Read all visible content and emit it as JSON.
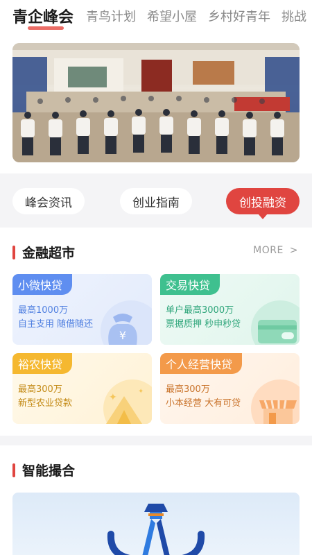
{
  "tabs": [
    {
      "label": "青企峰会",
      "active": true
    },
    {
      "label": "青鸟计划",
      "active": false
    },
    {
      "label": "希望小屋",
      "active": false
    },
    {
      "label": "乡村好青年",
      "active": false
    },
    {
      "label": "挑战",
      "active": false
    }
  ],
  "segments": [
    {
      "label": "峰会资讯",
      "active": false
    },
    {
      "label": "创业指南",
      "active": false
    },
    {
      "label": "创投融资",
      "active": true
    }
  ],
  "finance": {
    "title": "金融超市",
    "more_label": "MORE",
    "more_chevron": ">",
    "cards": [
      {
        "tag": "小微快贷",
        "line1": "最高1000万",
        "line2": "自主支用  随借随还",
        "icon": "money-bag-icon"
      },
      {
        "tag": "交易快贷",
        "line1": "单户最高3000万",
        "line2": "票据质押  秒申秒贷",
        "icon": "wallet-card-icon"
      },
      {
        "tag": "裕农快贷",
        "line1": "最高300万",
        "line2": "新型农业贷款",
        "icon": "farm-hill-icon"
      },
      {
        "tag": "个人经营快贷",
        "line1": "最高300万",
        "line2": "小本经营  大有可贷",
        "icon": "storefront-icon"
      }
    ]
  },
  "matching": {
    "title": "智能撮合"
  },
  "colors": {
    "accent_red": "#e04540",
    "blue": "#5f8ef0",
    "green": "#3fc08f",
    "yellow": "#f5b830",
    "orange": "#f39a4a"
  }
}
